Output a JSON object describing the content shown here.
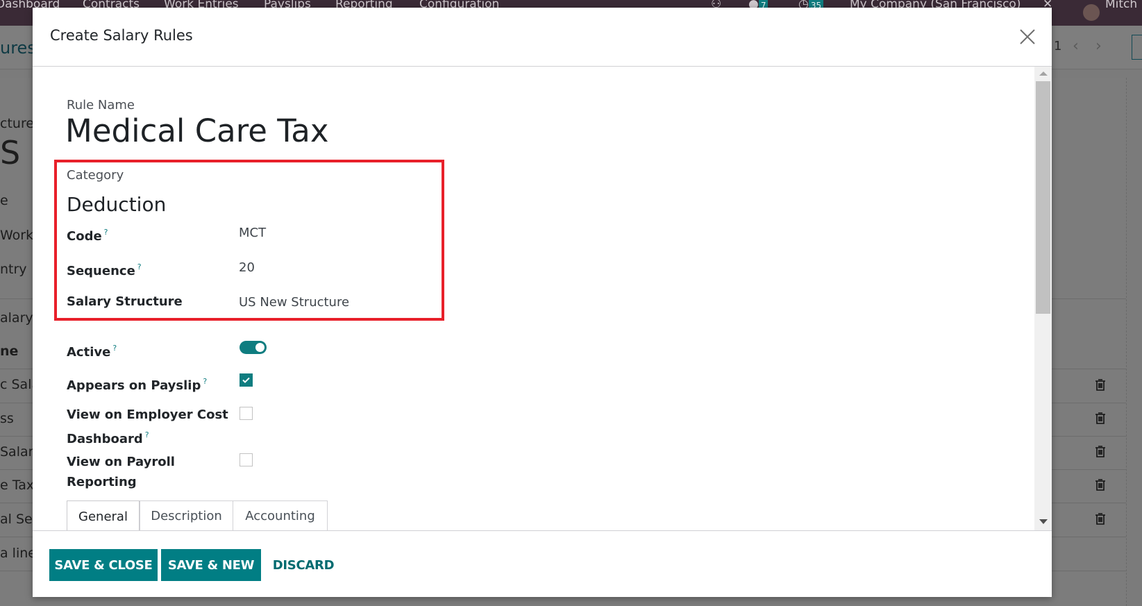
{
  "topbar": {
    "menu": [
      "Dashboard",
      "Contracts",
      "Work Entries",
      "Payslips",
      "Reporting",
      "Configuration"
    ],
    "messages_count": "7",
    "activities_count": "35",
    "company": "My Company (San Francisco)",
    "user": "Mitch"
  },
  "background": {
    "breadcrumb_fragment": "ures",
    "pager": "1",
    "labels": [
      "cture",
      "S N",
      "e",
      "Work",
      "ntry",
      "alary R",
      "ne"
    ],
    "rows": [
      "c Sala",
      "ss",
      "Salary",
      "e Tax",
      "al Sec",
      "a line"
    ]
  },
  "modal": {
    "title": "Create Salary Rules",
    "rule_name_label": "Rule Name",
    "rule_name_value": "Medical Care Tax",
    "category_label": "Category",
    "category_value": "Deduction",
    "fields": {
      "code": {
        "label": "Code",
        "help": "?",
        "value": "MCT"
      },
      "sequence": {
        "label": "Sequence",
        "help": "?",
        "value": "20"
      },
      "salary_structure": {
        "label": "Salary Structure",
        "value": "US New Structure"
      }
    },
    "toggles": {
      "active": {
        "label": "Active",
        "help": "?",
        "checked": true
      },
      "appears_on_payslip": {
        "label": "Appears on Payslip",
        "help": "?",
        "checked": true
      },
      "view_employer_cost": {
        "label_line1": "View on Employer Cost",
        "label_line2": "Dashboard",
        "help": "?",
        "checked": false
      },
      "view_payroll_reporting": {
        "label_line1": "View on Payroll",
        "label_line2": "Reporting",
        "checked": false
      }
    },
    "tabs": [
      {
        "label": "General",
        "active": true
      },
      {
        "label": "Description",
        "active": false
      },
      {
        "label": "Accounting",
        "active": false
      }
    ],
    "footer": {
      "save_close": "SAVE & CLOSE",
      "save_new": "SAVE & NEW",
      "discard": "DISCARD"
    }
  },
  "colors": {
    "primary": "#017e84",
    "highlight": "#e8202a",
    "topbar": "#3a2a36"
  }
}
